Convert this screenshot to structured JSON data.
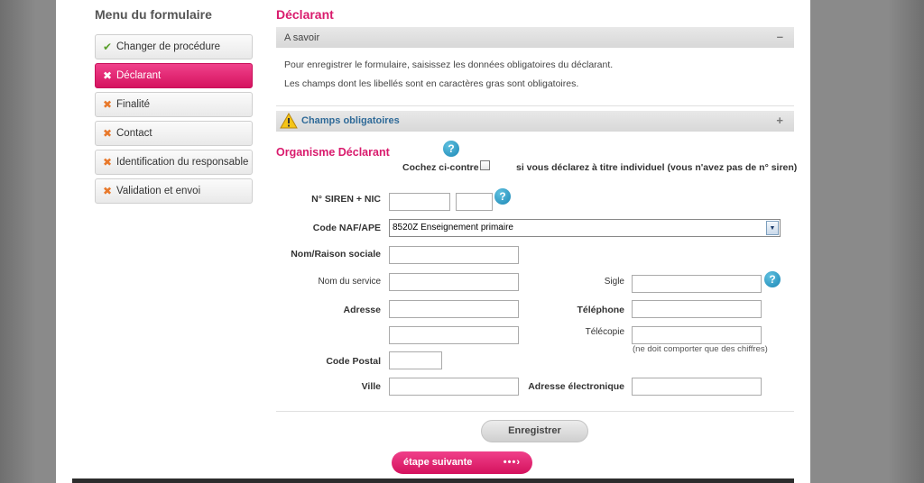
{
  "sidebar": {
    "title": "Menu du formulaire",
    "items": [
      {
        "label": "Changer de procédure",
        "state": "done"
      },
      {
        "label": "Déclarant",
        "state": "active"
      },
      {
        "label": "Finalité",
        "state": "todo"
      },
      {
        "label": "Contact",
        "state": "todo"
      },
      {
        "label": "Identification du responsable",
        "state": "todo"
      },
      {
        "label": "Validation et envoi",
        "state": "todo"
      }
    ]
  },
  "icons": {
    "check": "✔",
    "cross": "✖",
    "help": "?",
    "collapse": "–",
    "expand": "+",
    "next_dots": "•••›"
  },
  "colors": {
    "accent": "#d91b6d",
    "link": "#2f6a98",
    "help": "#1c87b5"
  },
  "main": {
    "title": "Déclarant",
    "a_savoir": {
      "header": "A savoir",
      "line1": "Pour enregistrer le formulaire, saisissez les données obligatoires du déclarant.",
      "line2": "Les champs dont les libellés sont en caractères gras sont obligatoires."
    },
    "champs_obligatoires": "Champs obligatoires",
    "organisme": {
      "title": "Organisme Déclarant",
      "cochez": "Cochez ci-contre",
      "individuel": "si vous déclarez à titre individuel (vous n'avez pas de n° siren)"
    },
    "fields": {
      "siren": "N° SIREN + NIC",
      "naf": "Code NAF/APE",
      "naf_value": "8520Z Enseignement primaire",
      "nom": "Nom/Raison sociale",
      "service": "Nom du service",
      "sigle": "Sigle",
      "adresse": "Adresse",
      "telephone": "Téléphone",
      "telecopie": "Télécopie",
      "telecopie_hint": "(ne doit comporter que des chiffres)",
      "code_postal": "Code Postal",
      "ville": "Ville",
      "email": "Adresse électronique"
    },
    "buttons": {
      "save": "Enregistrer",
      "next": "étape suivante"
    }
  }
}
